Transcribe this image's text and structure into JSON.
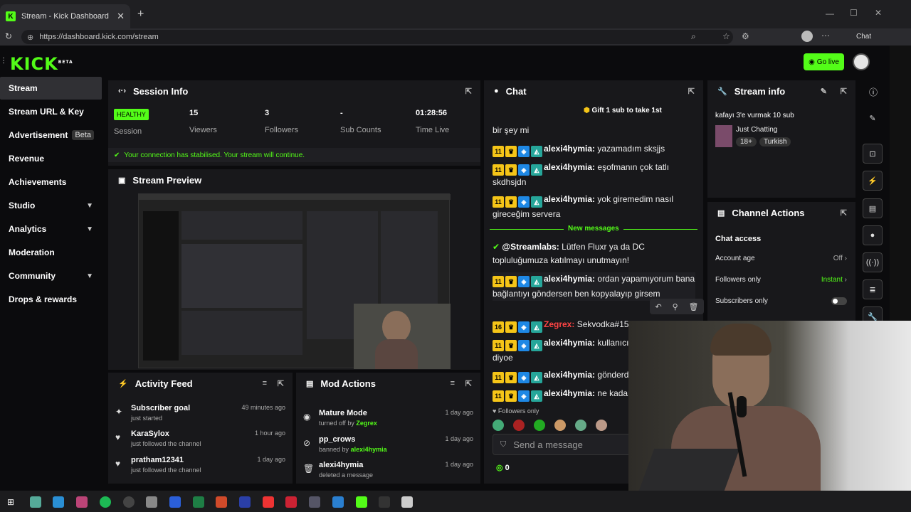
{
  "browser": {
    "tab_title": "Stream - Kick Dashboard",
    "url": "https://dashboard.kick.com/stream",
    "copilot_label": "Chat"
  },
  "header": {
    "logo": "KICK",
    "logo_badge": "BETA",
    "go_live_label": "Go live"
  },
  "sidebar": {
    "items": [
      {
        "label": "Stream",
        "active": true
      },
      {
        "label": "Stream URL & Key"
      },
      {
        "label": "Advertisement",
        "badge": "Beta"
      },
      {
        "label": "Revenue"
      },
      {
        "label": "Achievements"
      },
      {
        "label": "Studio",
        "expandable": true
      },
      {
        "label": "Analytics",
        "expandable": true
      },
      {
        "label": "Moderation"
      },
      {
        "label": "Community",
        "expandable": true
      },
      {
        "label": "Drops & rewards"
      }
    ]
  },
  "session_info": {
    "title": "Session Info",
    "status_badge": "HEALTHY",
    "status_label": "Session",
    "stats": [
      {
        "value": "15",
        "label": "Viewers"
      },
      {
        "value": "3",
        "label": "Followers"
      },
      {
        "value": "-",
        "label": "Sub Counts"
      },
      {
        "value": "01:28:56",
        "label": "Time Live"
      }
    ],
    "notice": "Your connection has stabilised. Your stream will continue."
  },
  "stream_preview": {
    "title": "Stream Preview"
  },
  "activity_feed": {
    "title": "Activity Feed",
    "items": [
      {
        "title": "Subscriber goal",
        "sub": "just started",
        "time": "49 minutes ago"
      },
      {
        "title": "KaraSylox",
        "sub": "just followed the channel",
        "time": "1 hour ago"
      },
      {
        "title": "pratham12341",
        "sub": "just followed the channel",
        "time": "1 day ago"
      }
    ]
  },
  "mod_actions": {
    "title": "Mod Actions",
    "items": [
      {
        "title": "Mature Mode",
        "sub": "turned off by",
        "actor": "Zegrex",
        "time": "1 day ago"
      },
      {
        "title": "pp_crows",
        "sub": "banned by",
        "actor": "alexi4hymia",
        "time": "1 day ago"
      },
      {
        "title": "alexi4hymia",
        "sub": "deleted a message",
        "actor": "",
        "time": "1 day ago"
      }
    ]
  },
  "chat": {
    "title": "Chat",
    "gift_banner": "Gift 1 sub to take 1st",
    "new_messages_label": "New messages",
    "messages": [
      {
        "badge": "11",
        "user": "",
        "text": "bir şey mi"
      },
      {
        "badge": "11",
        "user": "alexi4hymia:",
        "text": "yazamadım sksjjs"
      },
      {
        "badge": "11",
        "user": "alexi4hymia:",
        "text": "eşofmanın çok tatlı skdhsjdn"
      },
      {
        "badge": "11",
        "user": "alexi4hymia:",
        "text": "yok giremedim nasıl gireceğim servera"
      },
      {
        "badge": "",
        "user": "@Streamlabs:",
        "text": "Lütfen Fluxr ya da DC topluluğumuza katılmayı unutmayın!"
      },
      {
        "badge": "11",
        "user": "alexi4hymia:",
        "text": "ordan yapamıyorum bana bağlantıyı göndersen ben kopyalayıp girsem"
      },
      {
        "badge": "16",
        "user": "Zegrex:",
        "text": "Sekvodka#1551"
      },
      {
        "badge": "11",
        "user": "alexi4hymia:",
        "text": "kullanıcı bulunamadı diyoe"
      },
      {
        "badge": "11",
        "user": "alexi4hymia:",
        "text": "gönderdim"
      },
      {
        "badge": "11",
        "user": "alexi4hymia:",
        "text": "ne kadar uğraştık ya"
      }
    ],
    "followers_only_label": "Followers only",
    "input_placeholder": "Send a message",
    "points": "0"
  },
  "stream_info": {
    "title": "Stream info",
    "stream_title": "kafayı 3'e vurmak 10 sub",
    "category": "Just Chatting",
    "tags": [
      "18+",
      "Turkish"
    ]
  },
  "channel_actions": {
    "title": "Channel Actions",
    "section": "Chat access",
    "rows": [
      {
        "label": "Account age",
        "value": "Off"
      },
      {
        "label": "Followers only",
        "value": "Instant"
      },
      {
        "label": "Subscribers only",
        "value": ""
      }
    ]
  },
  "colors": {
    "accent": "#53fc18",
    "panel": "#18181b",
    "bg": "#0b0b0d"
  }
}
